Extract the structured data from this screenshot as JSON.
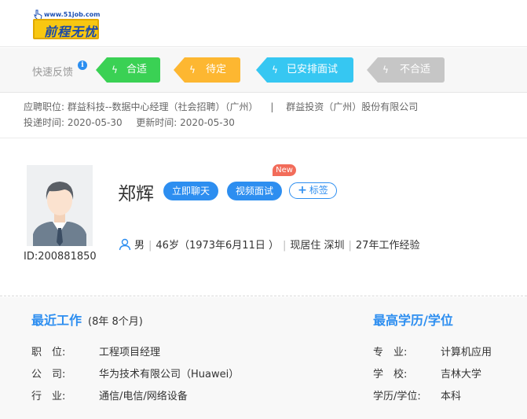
{
  "header": {
    "logo_url_text": "www.51job.com",
    "logo_text": "前程无忧"
  },
  "feedback": {
    "label": "快速反馈",
    "info_icon": "i",
    "tags": [
      {
        "label": "合适",
        "color": "#3ad154"
      },
      {
        "label": "待定",
        "color": "#fdb731"
      },
      {
        "label": "已安排面试",
        "color": "#36c7f2"
      },
      {
        "label": "不合适",
        "color": "#c6c6c6"
      }
    ]
  },
  "application": {
    "position_label": "应聘职位:",
    "position_value": "群益科技--数据中心经理（社会招聘）（广州）",
    "separator": "|",
    "company": "群益投资（广州）股份有限公司",
    "apply_time_label": "投递时间:",
    "apply_time": "2020-05-30",
    "update_time_label": "更新时间:",
    "update_time": "2020-05-30"
  },
  "profile": {
    "id": "ID:200881850",
    "name": "郑辉",
    "chat_button": "立即聊天",
    "video_button": "视频面试",
    "new_badge": "New",
    "tag_button": "标签",
    "tag_plus": "+",
    "gender": "男",
    "age": "46岁（1973年6月11日 ）",
    "location": "现居住 深圳",
    "experience": "27年工作经验",
    "bar": "|"
  },
  "recent_work": {
    "title": "最近工作",
    "duration": "(8年 8个月)",
    "rows": [
      {
        "label": "职　位:",
        "value": "工程项目经理"
      },
      {
        "label": "公　司:",
        "value": "华为技术有限公司（Huawei）"
      },
      {
        "label": "行　业:",
        "value": "通信/电信/网络设备"
      }
    ]
  },
  "education": {
    "title": "最高学历/学位",
    "rows": [
      {
        "label": "专　业:",
        "value": "计算机应用"
      },
      {
        "label": "学　校:",
        "value": "吉林大学"
      },
      {
        "label": "学历/学位:",
        "value": "本科"
      }
    ]
  },
  "colors": {
    "accent": "#2d8ef0",
    "badge": "#f26c5a"
  }
}
